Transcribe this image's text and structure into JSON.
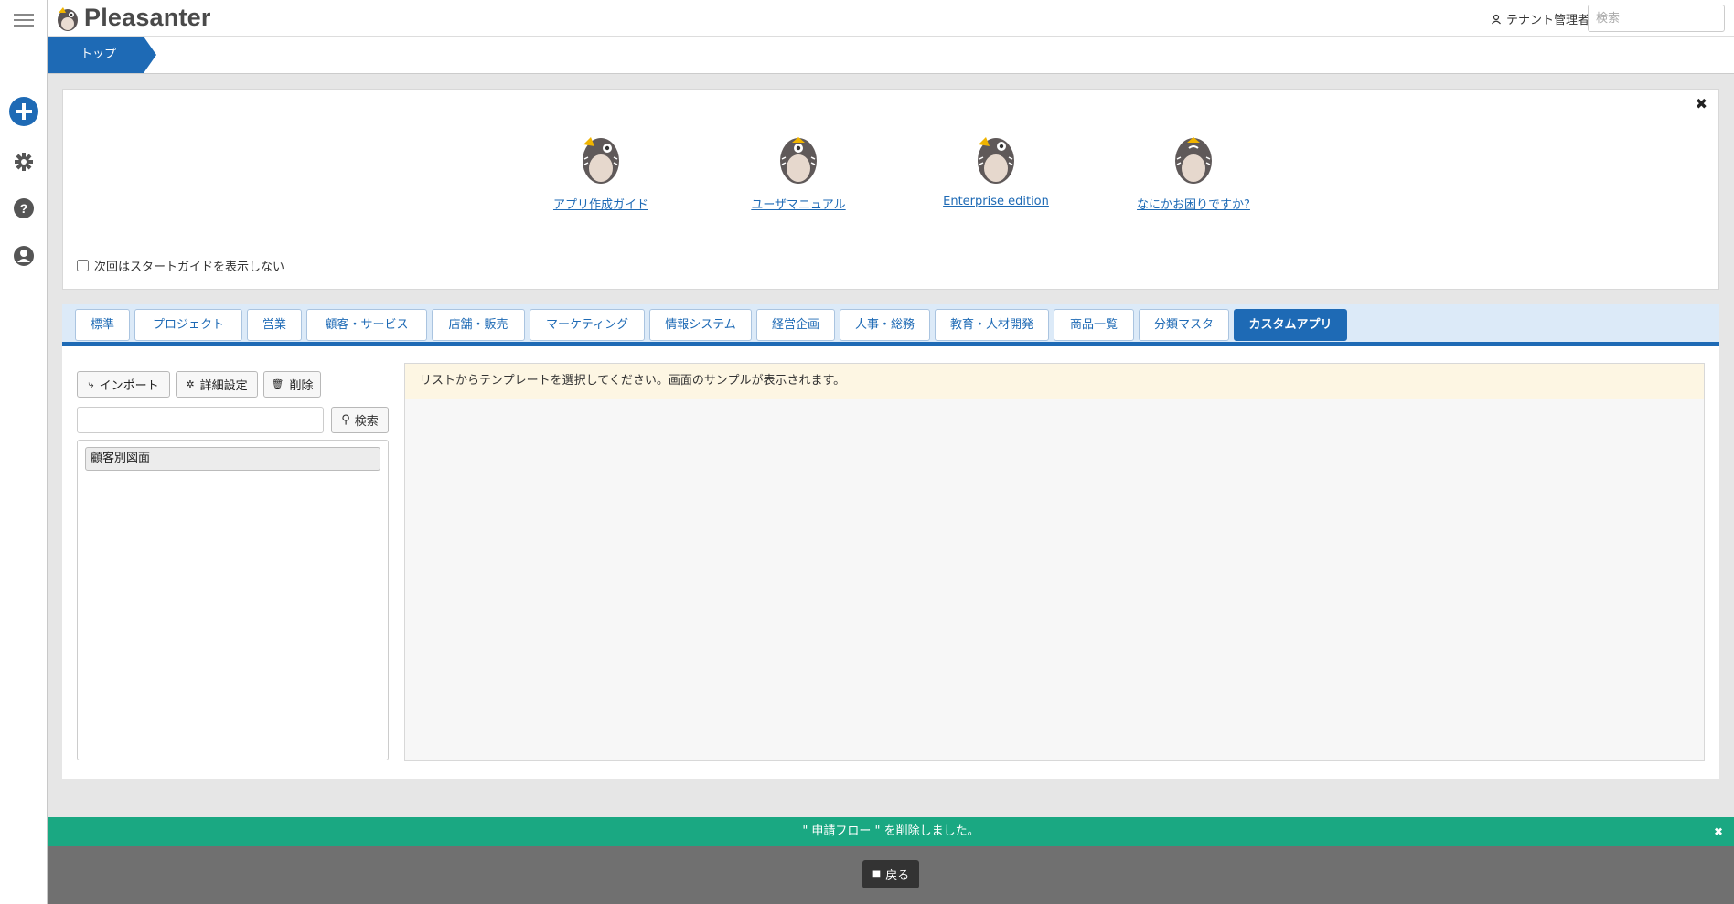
{
  "app": {
    "brand": "Pleasanter",
    "user_name": "テナント管理者",
    "search_placeholder": "検索"
  },
  "breadcrumb": {
    "items": [
      {
        "label": "トップ"
      }
    ]
  },
  "sidebar": {
    "icons": [
      "menu-icon",
      "plus-circle-icon",
      "gear-icon",
      "help-icon",
      "user-circle-icon"
    ]
  },
  "guide": {
    "close_label": "✖",
    "items": [
      {
        "label": "アプリ作成ガイド",
        "icon": "owl-icon"
      },
      {
        "label": "ユーザマニュアル",
        "icon": "owl-icon"
      },
      {
        "label": "Enterprise edition",
        "icon": "owl-icon"
      },
      {
        "label": "なにかお困りですか?",
        "icon": "owl-icon"
      }
    ],
    "checkbox_label": "次回はスタートガイドを表示しない"
  },
  "tabs": [
    {
      "label": "標準"
    },
    {
      "label": "プロジェクト"
    },
    {
      "label": "営業"
    },
    {
      "label": "顧客・サービス"
    },
    {
      "label": "店舗・販売"
    },
    {
      "label": "マーケティング"
    },
    {
      "label": "情報システム"
    },
    {
      "label": "経営企画"
    },
    {
      "label": "人事・総務"
    },
    {
      "label": "教育・人材開発"
    },
    {
      "label": "商品一覧"
    },
    {
      "label": "分類マスタ"
    },
    {
      "label": "カスタムアプリ",
      "active": true
    }
  ],
  "toolbar": {
    "import_label": "インポート",
    "settings_label": "詳細設定",
    "delete_label": "削除",
    "search_label": "検索"
  },
  "template_list": {
    "items": [
      {
        "label": "顧客別図面"
      }
    ]
  },
  "preview": {
    "message": "リストからテンプレートを選択してください。画面のサンプルが表示されます。"
  },
  "notification": {
    "message": "\" 申請フロー \" を削除しました。",
    "close_label": "✖"
  },
  "footer": {
    "back_label": "戻る"
  },
  "colors": {
    "accent": "#1e6ab5",
    "notice": "#1aa882",
    "footer": "#707070",
    "preview_msg_bg": "#fdf6e3"
  }
}
